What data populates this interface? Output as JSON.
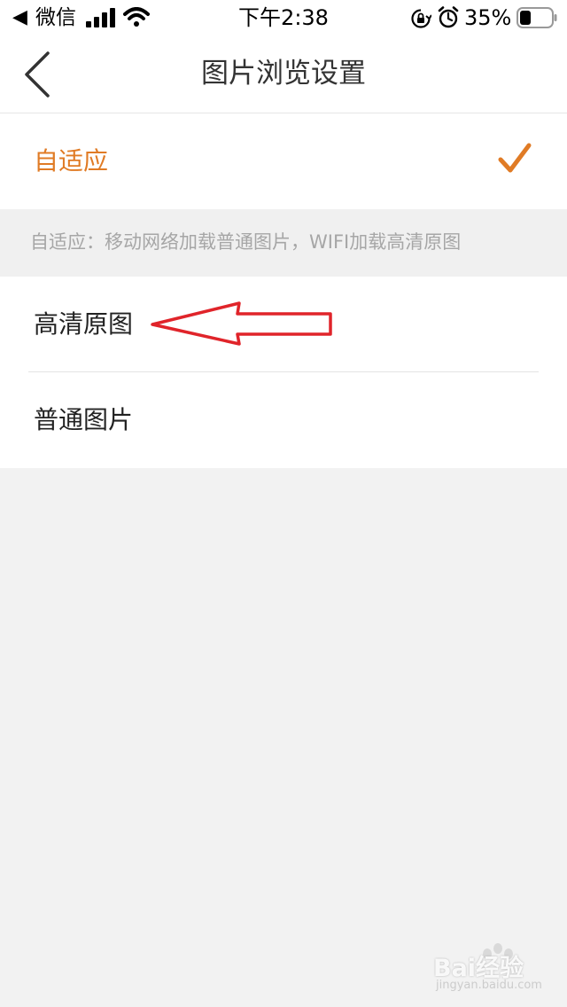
{
  "status_bar": {
    "back_glyph": "◀",
    "app_name": "微信",
    "time": "下午2:38",
    "battery_percent": "35%",
    "battery_level": 0.35,
    "icons": [
      "signal-icon",
      "wifi-icon",
      "rotation-lock-icon",
      "alarm-icon",
      "battery-icon"
    ]
  },
  "nav": {
    "title": "图片浏览设置",
    "back_icon": "chevron-left-icon"
  },
  "options": {
    "adaptive": {
      "label": "自适应",
      "selected": true
    },
    "hint": "自适应：移动网络加载普通图片，WIFI加载高清原图",
    "hd": {
      "label": "高清原图",
      "selected": false
    },
    "normal": {
      "label": "普通图片",
      "selected": false
    }
  },
  "annotation": {
    "icon": "red-arrow-left-icon",
    "color": "#e0242a"
  },
  "colors": {
    "accent": "#e07b25",
    "background": "#f2f2f2",
    "hint_text": "#a6a6a6"
  },
  "watermark": {
    "text": "Bai经验",
    "sub": "jingyan.baidu.com"
  }
}
